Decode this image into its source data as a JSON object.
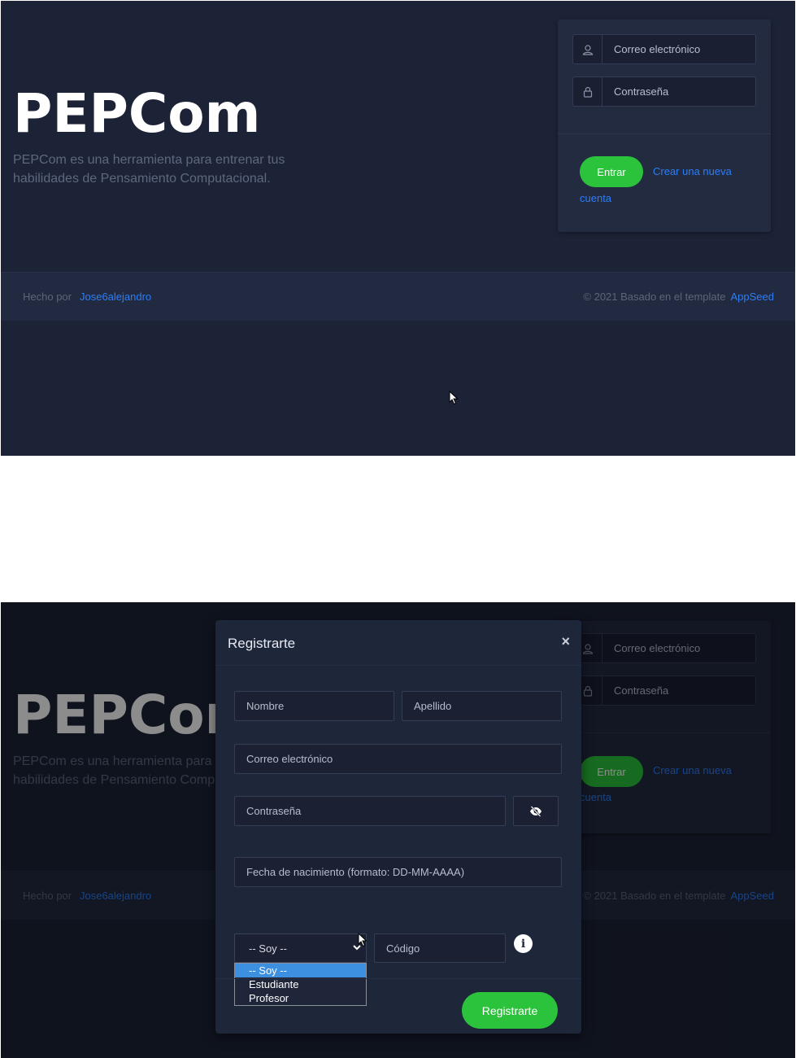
{
  "page1": {
    "hero": {
      "title": "PEPCom",
      "description": "PEPCom es una herramienta para entrenar tus habilidades de Pensamiento Computacional."
    },
    "login": {
      "email_placeholder": "Correo electrónico",
      "password_placeholder": "Contraseña",
      "submit_label": "Entrar",
      "register_link_line1": "Crear una nueva",
      "register_link_line2": "cuenta"
    },
    "footer": {
      "made_by": "Hecho por",
      "author": "Jose6alejandro",
      "copyright": "© 2021 Basado en el template",
      "template_name": "AppSeed"
    }
  },
  "page2": {
    "hero": {
      "title": "PEPCom",
      "description": "PEPCom es una herramienta para entrenar tus habilidades de Pensamiento Computacional."
    },
    "login": {
      "email_placeholder": "Correo electrónico",
      "password_placeholder": "Contraseña",
      "submit_label": "Entrar",
      "register_link_line1": "Crear una nueva",
      "register_link_line2": "cuenta"
    },
    "footer": {
      "made_by": "Hecho por",
      "author": "Jose6alejandro",
      "copyright": "© 2021 Basado en el template",
      "template_name": "AppSeed"
    },
    "modal": {
      "title": "Registrarte",
      "close_label": "×",
      "first_name_placeholder": "Nombre",
      "last_name_placeholder": "Apellido",
      "email_placeholder": "Correo electrónico",
      "password_placeholder": "Contraseña",
      "birthdate_placeholder": "Fecha de nacimiento (formato: DD-MM-AAAA)",
      "role_select": {
        "selected": "-- Soy --",
        "options": [
          "-- Soy --",
          "Estudiante",
          "Profesor"
        ]
      },
      "code_placeholder": "Código",
      "submit_label": "Registrarte"
    }
  },
  "colors": {
    "background": "#1d2337",
    "card": "#232b41",
    "accent_green": "#2bc33b",
    "link_blue": "#2d7df5",
    "select_highlight": "#3d8fe0"
  }
}
